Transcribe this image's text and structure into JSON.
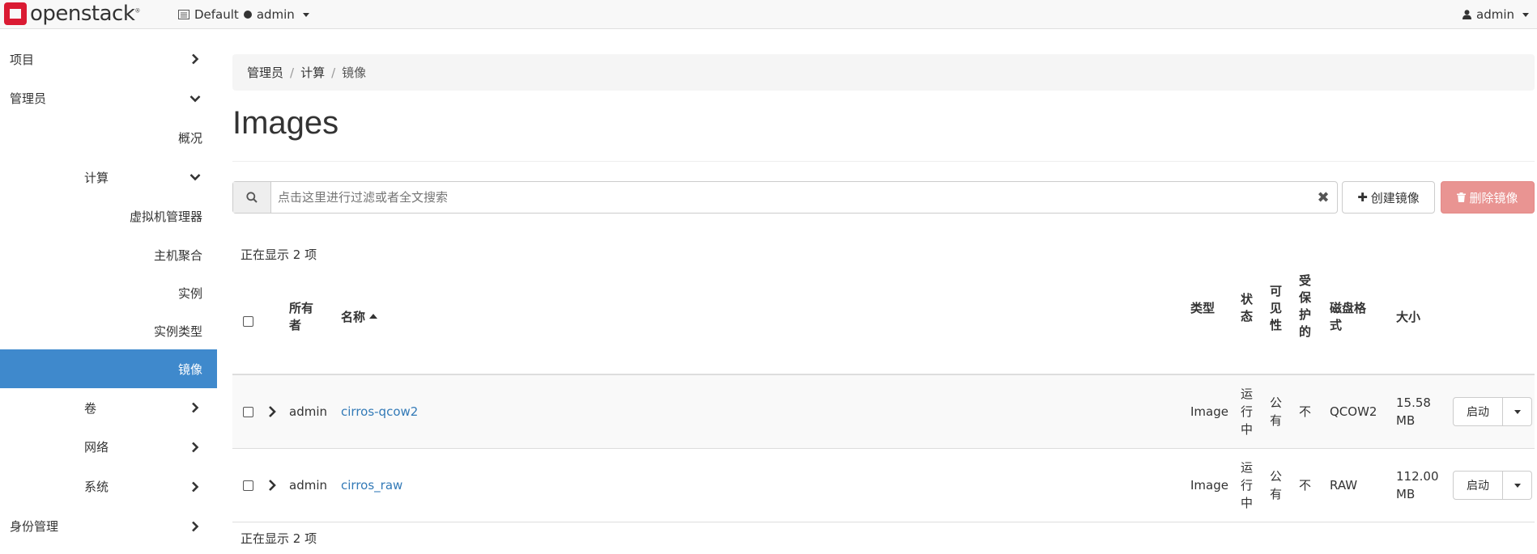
{
  "topbar": {
    "brand": "openstack",
    "domain": "Default",
    "project": "admin",
    "user": "admin"
  },
  "sidebar": {
    "items": [
      {
        "label": "项目",
        "level": 1,
        "chevron": "right"
      },
      {
        "label": "管理员",
        "level": 1,
        "chevron": "down"
      },
      {
        "label": "概况",
        "level": 3
      },
      {
        "label": "计算",
        "level": 2,
        "chevron": "down"
      },
      {
        "label": "虚拟机管理器",
        "level": 3
      },
      {
        "label": "主机聚合",
        "level": 3
      },
      {
        "label": "实例",
        "level": 3
      },
      {
        "label": "实例类型",
        "level": 3
      },
      {
        "label": "镜像",
        "level": 3,
        "active": true
      },
      {
        "label": "卷",
        "level": 2,
        "chevron": "right"
      },
      {
        "label": "网络",
        "level": 2,
        "chevron": "right"
      },
      {
        "label": "系统",
        "level": 2,
        "chevron": "right"
      },
      {
        "label": "身份管理",
        "level": 1,
        "chevron": "right"
      }
    ]
  },
  "breadcrumb": [
    "管理员",
    "计算",
    "镜像"
  ],
  "page_title": "Images",
  "search": {
    "placeholder": "点击这里进行过滤或者全文搜索",
    "value": ""
  },
  "actions": {
    "create": "创建镜像",
    "delete": "删除镜像"
  },
  "count_top": "正在显示 2 项",
  "count_bottom": "正在显示 2 项",
  "table": {
    "headers": {
      "owner": [
        "所有",
        "者"
      ],
      "name": "名称",
      "type": "类型",
      "status": [
        "状",
        "态"
      ],
      "visibility": [
        "可",
        "见",
        "性"
      ],
      "protected": [
        "受",
        "保",
        "护",
        "的"
      ],
      "disk_format": [
        "磁盘格",
        "式"
      ],
      "size": "大小"
    },
    "rows": [
      {
        "owner": "admin",
        "name": "cirros-qcow2",
        "type": "Image",
        "status": [
          "运",
          "行",
          "中"
        ],
        "visibility": [
          "公",
          "有"
        ],
        "protected": "不",
        "disk_format": "QCOW2",
        "size": [
          "15.58",
          "MB"
        ],
        "action": "启动"
      },
      {
        "owner": "admin",
        "name": "cirros_raw",
        "type": "Image",
        "status": [
          "运",
          "行",
          "中"
        ],
        "visibility": [
          "公",
          "有"
        ],
        "protected": "不",
        "disk_format": "RAW",
        "size": [
          "112.00",
          "MB"
        ],
        "action": "启动"
      }
    ]
  },
  "colors": {
    "accent": "#3f89cc",
    "link": "#337ab7",
    "danger": "#e99492",
    "brand": "#da1a32"
  }
}
